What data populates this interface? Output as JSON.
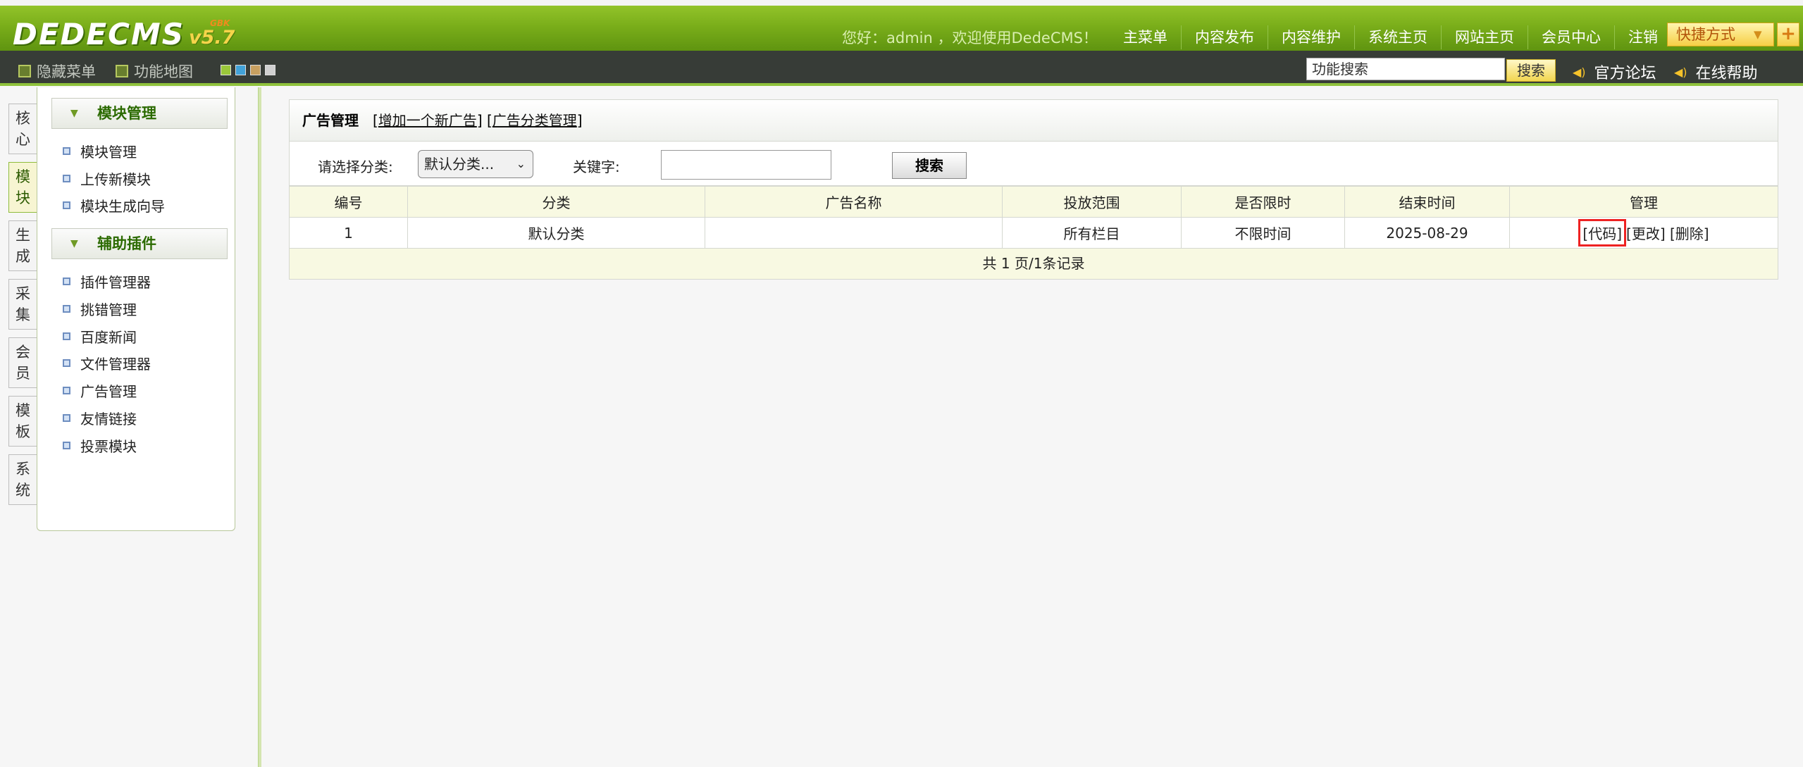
{
  "header": {
    "logo_text": "DEDECMS",
    "logo_version": "v5.7",
    "logo_sup": "GBK",
    "welcome": "您好：admin ，欢迎使用DedeCMS！",
    "nav": [
      "主菜单",
      "内容发布",
      "内容维护",
      "系统主页",
      "网站主页",
      "会员中心",
      "注销"
    ],
    "quick_label": "快捷方式",
    "plus": "+"
  },
  "toolbar": {
    "hide_menu": "隐藏菜单",
    "site_map": "功能地图",
    "search_value": "功能搜索",
    "search_button": "搜索",
    "forum": "官方论坛",
    "help": "在线帮助",
    "swatch_colors": [
      "#9ac63a",
      "#42a2d8",
      "#c8a060",
      "#d0d0d0"
    ]
  },
  "side_tabs": [
    {
      "label": "核心"
    },
    {
      "label": "模块"
    },
    {
      "label": "生成"
    },
    {
      "label": "采集"
    },
    {
      "label": "会员"
    },
    {
      "label": "模板"
    },
    {
      "label": "系统"
    }
  ],
  "left_menu": {
    "groups": [
      {
        "title": "模块管理",
        "items": [
          "模块管理",
          "上传新模块",
          "模块生成向导"
        ]
      },
      {
        "title": "辅助插件",
        "items": [
          "插件管理器",
          "挑错管理",
          "百度新闻",
          "文件管理器",
          "广告管理",
          "友情链接",
          "投票模块"
        ]
      }
    ]
  },
  "main": {
    "title": "广告管理",
    "link_add": "增加一个新广告",
    "link_category": "广告分类管理",
    "filter": {
      "category_label": "请选择分类:",
      "category_value": "默认分类...",
      "keyword_label": "关键字:",
      "search_button": "搜索"
    },
    "table": {
      "headers": [
        "编号",
        "分类",
        "广告名称",
        "投放范围",
        "是否限时",
        "结束时间",
        "管理"
      ],
      "rows": [
        {
          "id": "1",
          "category": "默认分类",
          "name": "",
          "scope": "所有栏目",
          "limited": "不限时间",
          "end": "2025-08-29",
          "actions": [
            "[代码]",
            "[更改]",
            "[删除]"
          ]
        }
      ]
    },
    "pager": "共 1 页/1条记录"
  }
}
